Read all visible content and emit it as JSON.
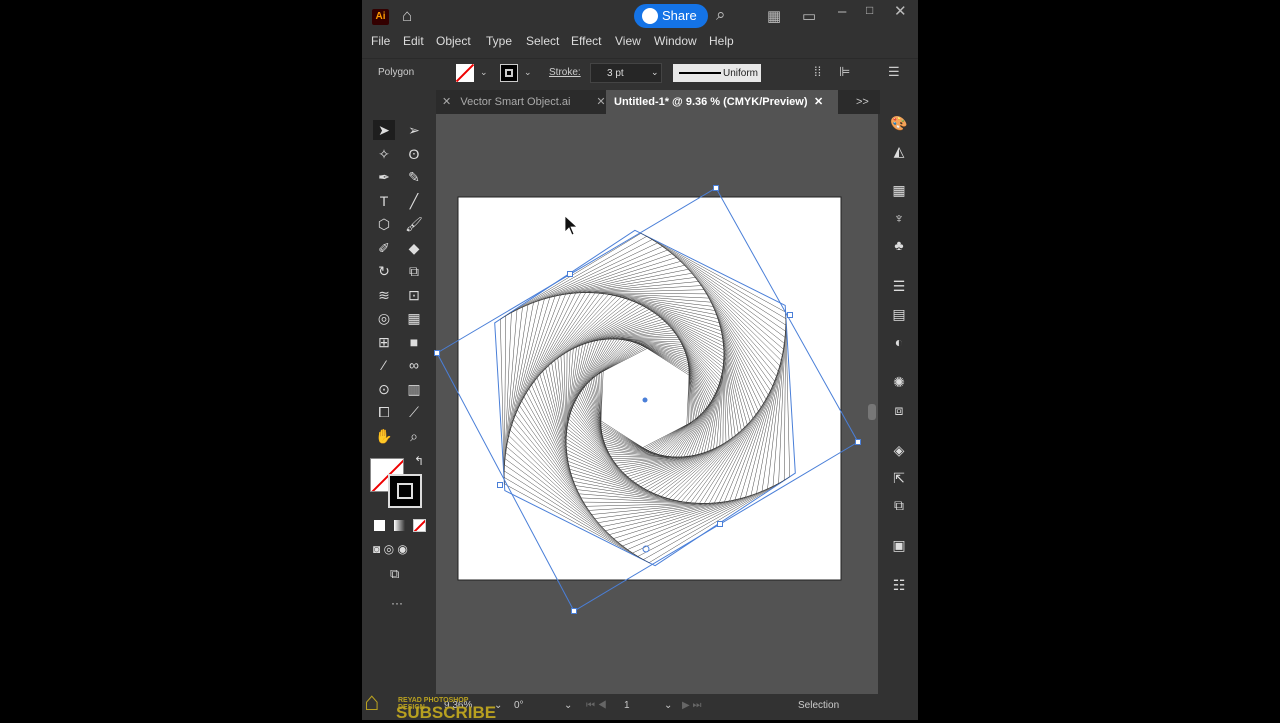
{
  "app": {
    "logo": "Ai",
    "share_label": "Share"
  },
  "menu": [
    "File",
    "Edit",
    "Object",
    "Type",
    "Select",
    "Effect",
    "View",
    "Window",
    "Help"
  ],
  "control": {
    "object_type": "Polygon",
    "stroke_label": "Stroke:",
    "stroke_weight": "3 pt",
    "profile": "Uniform"
  },
  "tabs": [
    {
      "label": "Vector Smart Object.ai",
      "active": false
    },
    {
      "label": "Untitled-1* @ 9.36 % (CMYK/Preview)",
      "active": true
    }
  ],
  "status": {
    "zoom": "9.36%",
    "rotation": "0°",
    "artboard": "1",
    "tool": "Selection"
  },
  "watermark": {
    "line1": "REYAD PHOTOSHOP DESIGN",
    "line2": "SUBSCRIBE"
  },
  "colors": {
    "selection": "#4a7fd8",
    "accent": "#1473e6",
    "artboard": "#ffffff",
    "canvas": "#535353"
  }
}
